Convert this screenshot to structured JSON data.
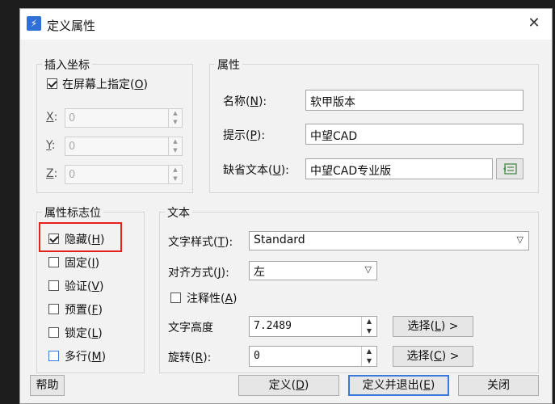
{
  "window": {
    "title": "定义属性",
    "close_symbol": "✕",
    "app_icon_glyph": "⚡"
  },
  "insert_point": {
    "legend": "插入坐标",
    "on_screen": {
      "label": "在屏幕上指定(",
      "key": "O",
      "label_end": ")",
      "checked": true
    },
    "x": {
      "label": "X",
      "suffix": ":",
      "value": "0"
    },
    "y": {
      "label": "Y",
      "suffix": ":",
      "value": "0"
    },
    "z": {
      "label": "Z",
      "suffix": ":",
      "value": "0"
    }
  },
  "attribute": {
    "legend": "属性",
    "name": {
      "label": "名称(",
      "key": "N",
      "label_end": "):",
      "value": "软甲版本"
    },
    "prompt": {
      "label": "提示(",
      "key": "P",
      "label_end": "):",
      "value": "中望CAD"
    },
    "default": {
      "label": "缺省文本(",
      "key": "U",
      "label_end": "):",
      "value": "中望CAD专业版"
    }
  },
  "flags": {
    "legend": "属性标志位",
    "items": [
      {
        "label": "隐藏(",
        "key": "H",
        "end": ")",
        "checked": true
      },
      {
        "label": "固定(",
        "key": "I",
        "end": ")",
        "checked": false
      },
      {
        "label": "验证(",
        "key": "V",
        "end": ")",
        "checked": false
      },
      {
        "label": "预置(",
        "key": "F",
        "end": ")",
        "checked": false
      },
      {
        "label": "锁定(",
        "key": "L",
        "end": ")",
        "checked": false
      },
      {
        "label": "多行(",
        "key": "M",
        "end": ")",
        "checked": false
      }
    ]
  },
  "text": {
    "legend": "文本",
    "style": {
      "label": "文字样式(",
      "key": "T",
      "label_end": "):",
      "value": "Standard"
    },
    "justify": {
      "label": "对齐方式(",
      "key": "J",
      "label_end": "):",
      "value": "左"
    },
    "annotative": {
      "label": "注释性(",
      "key": "A",
      "label_end": ")",
      "checked": false
    },
    "height": {
      "label": "文字高度",
      "value": "7.2489",
      "pick_label": "选择(",
      "pick_key": "L",
      "pick_end": ")  >"
    },
    "rotation": {
      "label": "旋转(",
      "key": "R",
      "label_end": "):",
      "value": "0",
      "pick_label": "选择(",
      "pick_key": "C",
      "pick_end": ")  >"
    }
  },
  "buttons": {
    "help": "帮助",
    "define": {
      "label": "定义(",
      "key": "D",
      "end": ")"
    },
    "define_exit": {
      "label": "定义并退出(",
      "key": "E",
      "end": ")"
    },
    "close": "关闭"
  },
  "colors": {
    "highlight": "#e8201c",
    "accent": "#3b78d8"
  }
}
